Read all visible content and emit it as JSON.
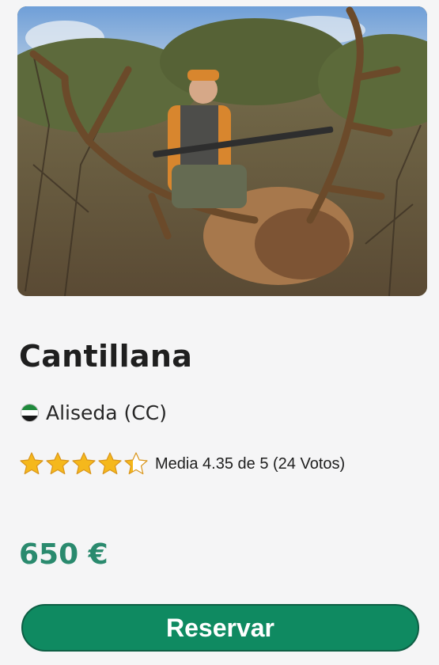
{
  "listing": {
    "image_alt": "hunter with red deer trophy",
    "title": "Cantillana",
    "location": "Aliseda (CC)",
    "flag_icon": "extremadura-flag-icon",
    "rating": {
      "value": 4.35,
      "max": 5,
      "text": "Media 4.35 de 5 (24 Votos)",
      "star_color": "#f5b81c"
    },
    "price": "650 €",
    "reserve_label": "Reservar",
    "accent_color": "#0f8a61"
  }
}
